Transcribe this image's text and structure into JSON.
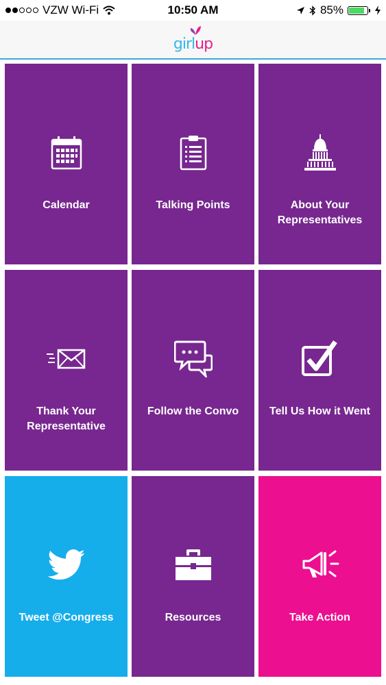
{
  "status_bar": {
    "carrier": "VZW Wi-Fi",
    "time": "10:50 AM",
    "battery": "85%",
    "battery_level": 0.85,
    "icons": [
      "signal-dots",
      "wifi-icon",
      "location-arrow-icon",
      "bluetooth-icon",
      "battery-icon",
      "charging-icon"
    ]
  },
  "header": {
    "logo": {
      "girl": "girl",
      "up": "up"
    }
  },
  "tiles": [
    {
      "label": "Calendar",
      "icon": "calendar-icon",
      "color": "#77278f"
    },
    {
      "label": "Talking Points",
      "icon": "clipboard-icon",
      "color": "#77278f"
    },
    {
      "label": "About Your Representatives",
      "icon": "capitol-icon",
      "color": "#77278f"
    },
    {
      "label": "Thank Your Representative",
      "icon": "envelope-icon",
      "color": "#77278f"
    },
    {
      "label": "Follow the Convo",
      "icon": "chat-bubbles-icon",
      "color": "#77278f"
    },
    {
      "label": "Tell Us How it Went",
      "icon": "checkbox-icon",
      "color": "#77278f"
    },
    {
      "label": "Tweet @Congress",
      "icon": "twitter-icon",
      "color": "#16adeb"
    },
    {
      "label": "Resources",
      "icon": "toolbox-icon",
      "color": "#77278f"
    },
    {
      "label": "Take Action",
      "icon": "megaphone-icon",
      "color": "#ec0f8f"
    }
  ],
  "colors": {
    "purple": "#77278f",
    "blue": "#16adeb",
    "pink": "#ec0f8f",
    "header_line": "#38a8e0"
  }
}
